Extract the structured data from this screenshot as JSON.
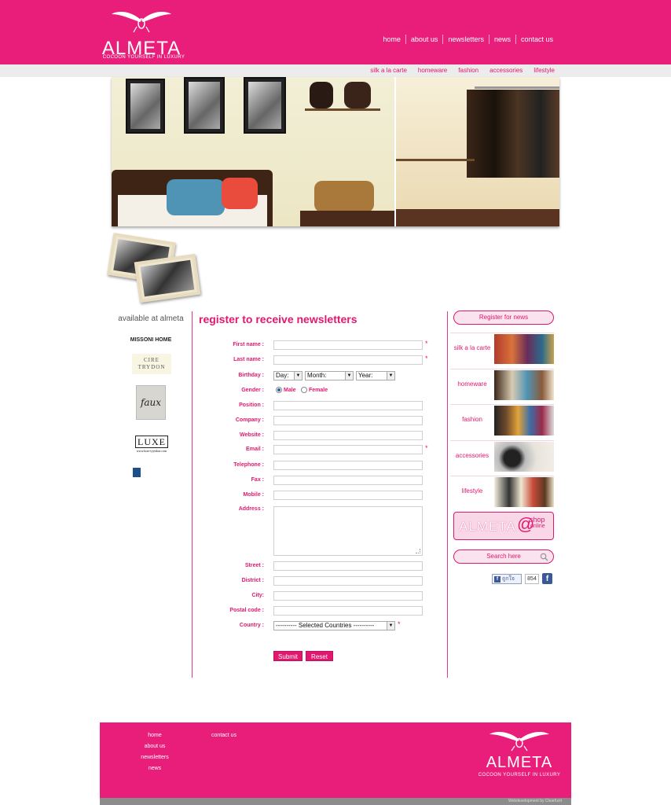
{
  "brand": {
    "name": "ALMETA",
    "tagline": "COCOON YOURSELF IN LUXURY"
  },
  "topnav": [
    "home",
    "about us",
    "newsletters",
    "news",
    "contact us"
  ],
  "subnav": [
    "silk a la carte",
    "homeware",
    "fashion",
    "accessories",
    "lifestyle"
  ],
  "left": {
    "heading": "available at almeta",
    "brands": {
      "missoni": "MISSONI HOME",
      "cire_1": "CIRE",
      "cire_2": "TRYDON",
      "faux": "faux",
      "luxe": "LUXE",
      "luxe_sub": "www.luxe-tyyedon.com"
    }
  },
  "form": {
    "title": "register to receive newsletters",
    "labels": {
      "first_name": "First name :",
      "last_name": "Last name :",
      "birthday": "Birthday :",
      "gender": "Gender :",
      "position": "Position :",
      "company": "Company :",
      "website": "Website :",
      "email": "Email :",
      "telephone": "Telephone :",
      "fax": "Fax :",
      "mobile": "Mobile :",
      "address": "Address :",
      "street": "Street :",
      "district": "District :",
      "city": "City:",
      "postal_code": "Postal code :",
      "country": "Country :"
    },
    "required_mark": "*",
    "birthday": {
      "day": "Day:",
      "month": "Month:",
      "year": "Year:"
    },
    "gender": {
      "male": "Male",
      "female": "Female",
      "selected": "Male"
    },
    "country_value": "---------- Selected Countries ----------",
    "submit": "Submit",
    "reset": "Reset"
  },
  "right": {
    "register_button": "Register for news",
    "categories": [
      "silk a la carte",
      "homeware",
      "fashion",
      "accessories",
      "lifestyle"
    ],
    "shop": {
      "main": "ALMETA",
      "at": "@",
      "line1": "shop",
      "line2": "online"
    },
    "search_placeholder": "Search here",
    "facebook": {
      "like_label": "ถูกใจ",
      "count": "854"
    }
  },
  "footer": {
    "col1": [
      "home",
      "about us",
      "newsletters",
      "news"
    ],
    "col2": [
      "contact us"
    ],
    "credit": "Webdevelopment by Clearfuzit"
  },
  "colors": {
    "brand_pink": "#e91e7a",
    "text_pink": "#e2186f"
  }
}
